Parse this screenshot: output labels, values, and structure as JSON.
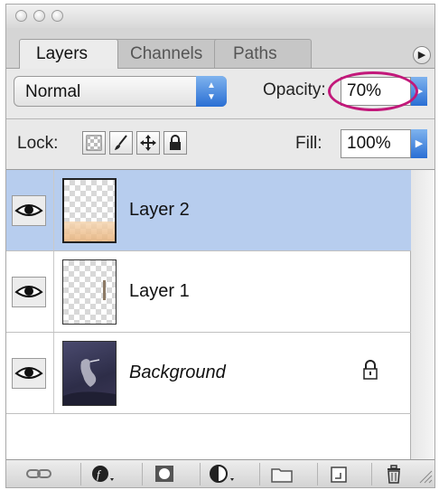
{
  "tabs": [
    {
      "label": "Layers",
      "active": true
    },
    {
      "label": "Channels",
      "active": false
    },
    {
      "label": "Paths",
      "active": false
    }
  ],
  "blend_mode": {
    "value": "Normal"
  },
  "opacity": {
    "label": "Opacity:",
    "value": "70%",
    "highlight_color": "#c2187a"
  },
  "lock": {
    "label": "Lock:",
    "buttons": [
      "lock-transparent-pixels-icon",
      "lock-image-pixels-icon",
      "lock-position-icon",
      "lock-all-icon"
    ]
  },
  "fill": {
    "label": "Fill:",
    "value": "100%"
  },
  "layers": [
    {
      "name": "Layer 2",
      "selected": true,
      "visible": true
    },
    {
      "name": "Layer 1",
      "selected": false,
      "visible": true
    },
    {
      "name": "Background",
      "selected": false,
      "visible": true,
      "locked": true,
      "italic": true
    }
  ],
  "colors": {
    "selection": "#b7cdee",
    "accent_blue": "#2a6fd4"
  },
  "bottom_bar_icons": [
    "link-layers-icon",
    "layer-style-icon",
    "layer-mask-icon",
    "adjustment-layer-icon",
    "new-group-icon",
    "new-layer-icon",
    "trash-icon"
  ]
}
